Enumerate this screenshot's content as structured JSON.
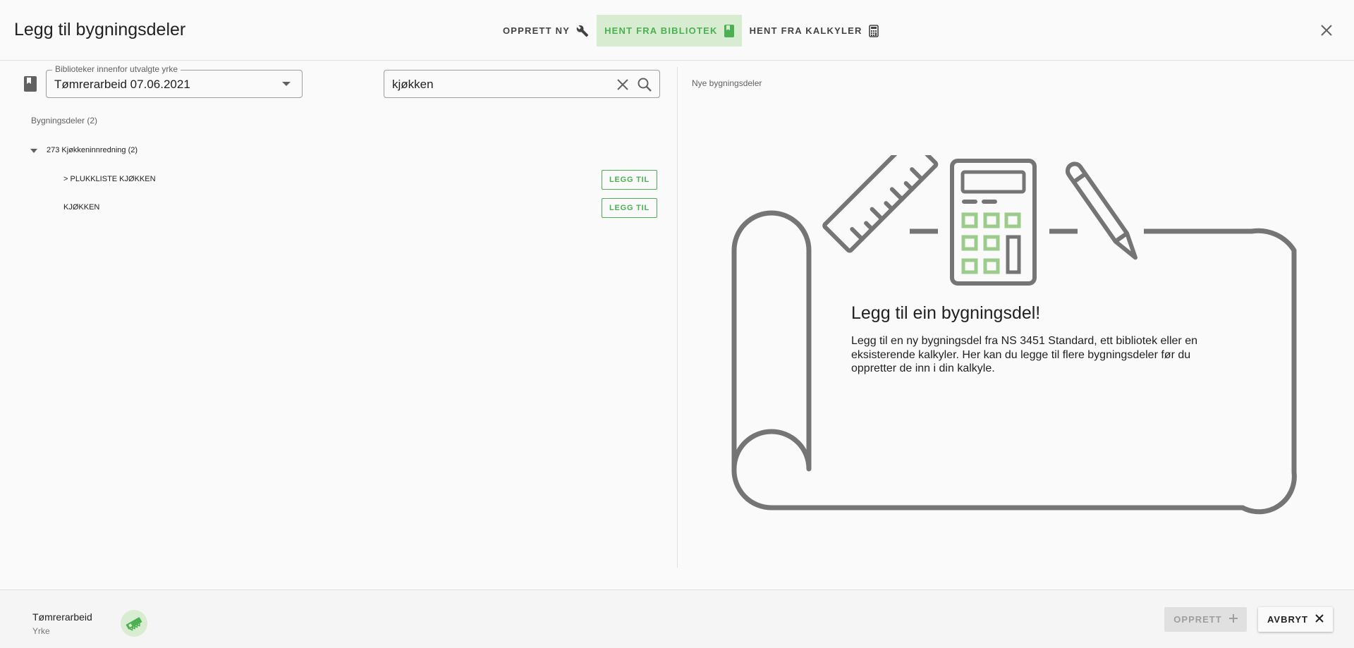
{
  "header": {
    "title": "Legg til bygningsdeler",
    "tabs": [
      {
        "label": "OPPRETT NY",
        "icon": "wrench-icon",
        "active": false
      },
      {
        "label": "HENT FRA BIBLIOTEK",
        "icon": "book-icon",
        "active": true
      },
      {
        "label": "HENT FRA KALKYLER",
        "icon": "calculator-icon",
        "active": false
      }
    ],
    "close_icon": "close-icon"
  },
  "left": {
    "library_select": {
      "label": "Biblioteker innenfor utvalgte yrke",
      "value": "Tømrerarbeid 07.06.2021"
    },
    "search": {
      "value": "kjøkken",
      "placeholder": ""
    },
    "section_label": "Bygningsdeler (2)",
    "tree": {
      "node_label": "273 Kjøkkeninnredning (2)",
      "items": [
        {
          "label": "> PLUKKLISTE KJØKKEN",
          "button": "LEGG TIL"
        },
        {
          "label": "KJØKKEN",
          "button": "LEGG TIL"
        }
      ]
    }
  },
  "right": {
    "label": "Nye bygningsdeler",
    "empty_title": "Legg til ein bygningsdel!",
    "empty_text": "Legg til en ny bygningsdel fra NS 3451 Standard, ett bibliotek eller en eksisterende kalkyler. Her kan du legge til flere bygningsdeler før du oppretter de inn i din kalkyle."
  },
  "footer": {
    "trade_name": "Tømrerarbeid",
    "trade_sub": "Yrke",
    "create_label": "OPPRETT",
    "cancel_label": "AVBRYT"
  },
  "colors": {
    "accent": "#4caf50",
    "accent_bg": "#d7ecd1",
    "illustration_gray": "#757575"
  }
}
